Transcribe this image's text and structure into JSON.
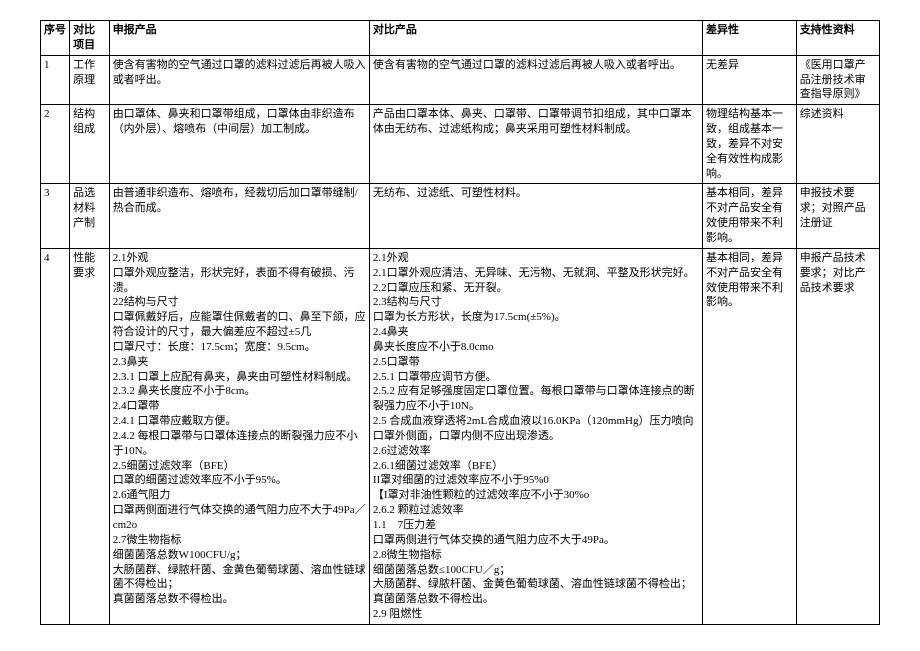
{
  "headers": {
    "seq": "序号",
    "item": "对比项目",
    "decl": "申报产品",
    "comp": "对比产品",
    "diff": "差异性",
    "supp": "支持性资料"
  },
  "rows": [
    {
      "seq": "1",
      "item": "工作原理",
      "decl": "使含有害物的空气通过口罩的滤料过滤后再被人吸入或者呼出。",
      "comp": "使含有害物的空气通过口罩的滤料过滤后再被人吸入或者呼出。",
      "diff": "无差异",
      "supp": "《医用口罩产品注册技术审查指导原则》"
    },
    {
      "seq": "2",
      "item": "结构组成",
      "decl": "由口罩体、鼻夹和口罩带组成，口罩体由非织造布（内外层）、熔喷布（中间层）加工制成。",
      "comp": "产品由口罩本体、鼻夹、口罩带、口罩带调节扣组成，其中口罩本体由无纺布、过滤纸构成；鼻夹采用可塑性材料制成。",
      "diff": "物理结构基本一致，组成基本一致，差异不对安全有效性构成影响。",
      "supp": "综述资料"
    },
    {
      "seq": "3",
      "item": "品选材料产制",
      "decl": "由普通非织造布、熔喷布，经裁切后加口罩带缝制/热合而成。",
      "comp": "无纺布、过滤纸、可塑性材料。",
      "diff": "基本相同，差异不对产品安全有效使用带来不利影响。",
      "supp": "申报技术要求；对照产品注册证"
    },
    {
      "seq": "4",
      "item": "性能要求",
      "decl": "2.1外观\n口罩外观应整洁，形状完好，表面不得有破损、污溃。\n22结构与尺寸\n口罩佩戴好后，应能罩住佩戴者的口、鼻至下颌，应符合设计的尺寸，最大偏差应不超过±5几\n口罩尺寸：长度：17.5cm；宽度：9.5cm。\n2.3鼻夹\n2.3.1 口罩上应配有鼻夹，鼻夹由可塑性材料制成。\n2.3.2 鼻夹长度应不小于8cm。\n2.4口罩带\n2.4.1 口罩带应戴取方便。\n2.4.2 每根口罩带与口罩体连接点的断裂强力应不小于10N。\n2.5细菌过滤效率（BFE）\n口罩的细菌过滤效率应不小于95%。\n2.6通气阻力\n口罩两侧面进行气体交换的通气阻力应不大于49Pa／cm2o\n2.7微生物指标\n细菌菌落总数W100CFU/g；\n大肠菌群、绿脓杆菌、金黄色葡萄球菌、溶血性链球菌不得检出；\n真菌菌落总数不得检出。",
      "comp": "2.1外观\n2.1口罩外观应清洁、无异味、无污物、无就洞、平整及形状完好。\n2.2口罩应压和紧、无开裂。\n2.3结构与尺寸\n口罩为长方形状，长度为17.5cm(±5%)。\n2.4鼻夹\n鼻夹长度应不小于8.0cmo\n2.5口罩带\n2.5.1 口罩带应调节方便。\n2.5.2 应有足够强度固定口罩位置。每根口罩带与口罩体连接点的断裂强力应不小于10N。\n2.5 合成血液穿透将2mL合成血液以16.0KPa（120mmHg）压力喷向口罩外侧面，口罩内侧不应出现渗透。\n2.6过滤效率\n2.6.1细菌过滤效率（BFE）\nII罩对细菌的过滤效率应不小于95%0\n【I罩对非油性颗粒的过滤效率应不小于30%o\n2.6.2 颗粒过滤效率\n1.1　7压力差\n口罩两侧进行气体交换的通气阻力应不大于49Pa。\n2.8微生物指标\n细菌菌落总数≤100CFU／g；\n大肠菌群、绿脓杆菌、金黄色葡萄球菌、溶血性链球菌不得检出；\n真菌菌落总数不得检出。\n2.9 阻燃性",
      "diff": "基本相同，差异不对产品安全有效使用带来不利影响。",
      "supp": "申报产品技术要求；对比产品技术要求"
    }
  ]
}
